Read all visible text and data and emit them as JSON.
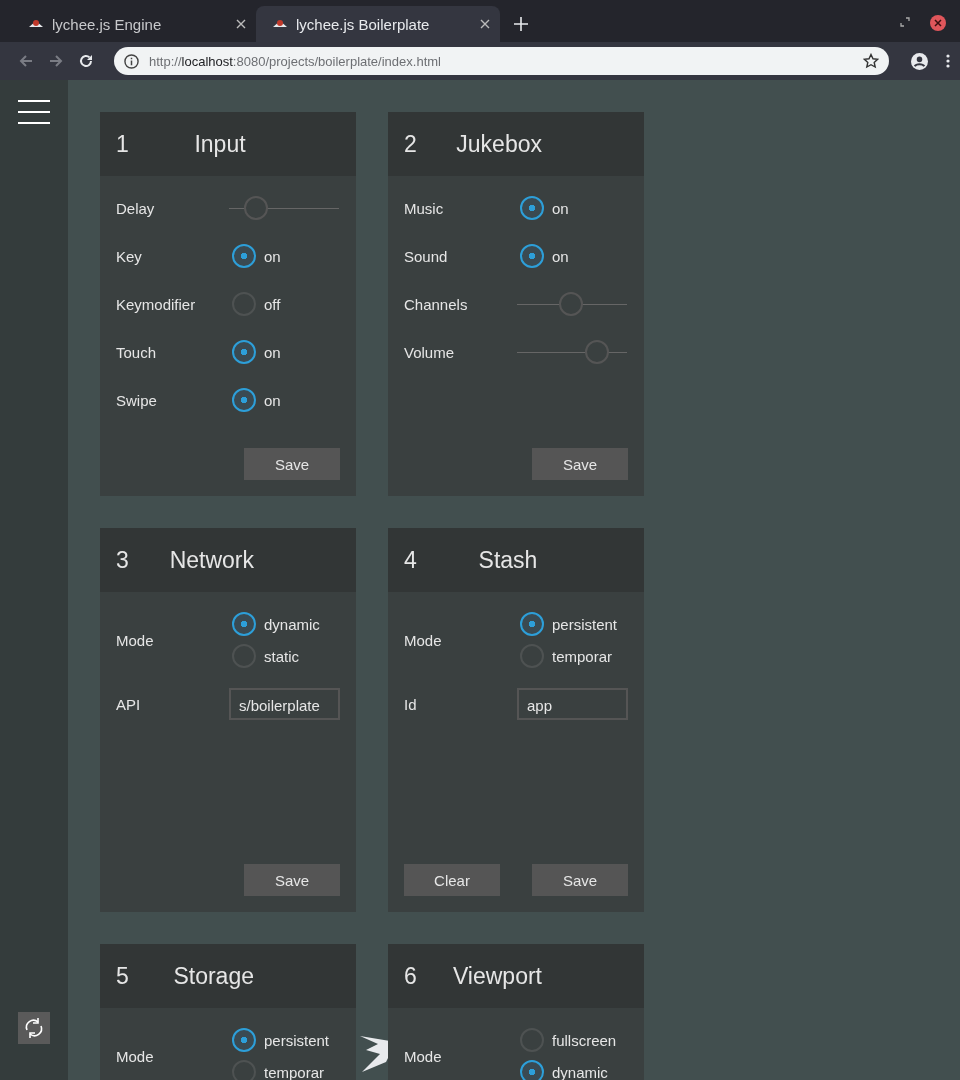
{
  "browser": {
    "tabs": [
      {
        "title": "lychee.js Engine",
        "selected": false
      },
      {
        "title": "lychee.js Boilerplate",
        "selected": true
      }
    ],
    "url": "http://**localhost**:8080/projects/boilerplate/index.html"
  },
  "cards": [
    {
      "number": "1",
      "title": "Input",
      "rows": [
        {
          "kind": "slider",
          "label": "Delay",
          "level": 0.17
        },
        {
          "kind": "toggle",
          "label": "Key",
          "on": true,
          "state_label": "on"
        },
        {
          "kind": "toggle",
          "label": "Keymodifier",
          "on": false,
          "state_label": "off"
        },
        {
          "kind": "toggle",
          "label": "Touch",
          "on": true,
          "state_label": "on"
        },
        {
          "kind": "toggle",
          "label": "Swipe",
          "on": true,
          "state_label": "on"
        }
      ],
      "buttons": [
        "Save"
      ]
    },
    {
      "number": "2",
      "title": "Jukebox",
      "rows": [
        {
          "kind": "toggle",
          "label": "Music",
          "on": true,
          "state_label": "on"
        },
        {
          "kind": "toggle",
          "label": "Sound",
          "on": true,
          "state_label": "on"
        },
        {
          "kind": "slider",
          "label": "Channels",
          "level": 0.49
        },
        {
          "kind": "slider",
          "label": "Volume",
          "level": 0.79
        }
      ],
      "buttons": [
        "Save"
      ]
    },
    {
      "number": "3",
      "title": "Network",
      "rows": [
        {
          "kind": "radio",
          "label": "Mode",
          "options": [
            {
              "label": "dynamic",
              "selected": true
            },
            {
              "label": "static",
              "selected": false
            }
          ]
        },
        {
          "kind": "input",
          "label": "API",
          "value": "s/boilerplate"
        }
      ],
      "buttons": [
        "Save"
      ]
    },
    {
      "number": "4",
      "title": "Stash",
      "rows": [
        {
          "kind": "radio",
          "label": "Mode",
          "options": [
            {
              "label": "persistent",
              "selected": true
            },
            {
              "label": "temporar",
              "selected": false
            }
          ]
        },
        {
          "kind": "input",
          "label": "Id",
          "value": "app"
        }
      ],
      "buttons": [
        "Clear",
        "Save"
      ]
    },
    {
      "number": "5",
      "title": "Storage",
      "rows": [
        {
          "kind": "radio",
          "label": "Mode",
          "options": [
            {
              "label": "persistent",
              "selected": true
            },
            {
              "label": "temporar",
              "selected": false
            }
          ]
        }
      ]
    },
    {
      "number": "6",
      "title": "Viewport",
      "rows": [
        {
          "kind": "radio",
          "label": "Mode",
          "options": [
            {
              "label": "fullscreen",
              "selected": false
            },
            {
              "label": "dynamic",
              "selected": true
            }
          ]
        }
      ]
    }
  ]
}
